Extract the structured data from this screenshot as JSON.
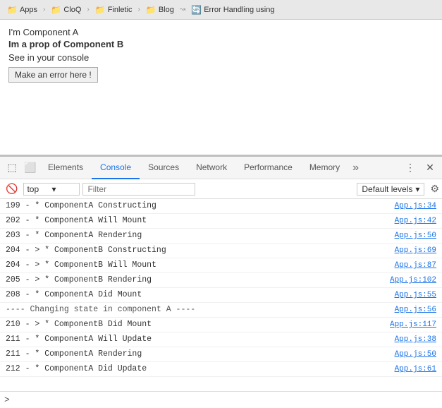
{
  "tabbar": {
    "items": [
      {
        "label": "Apps",
        "icon": "📁"
      },
      {
        "label": "CloQ",
        "icon": "📁"
      },
      {
        "label": "Finletic",
        "icon": "📁"
      },
      {
        "label": "Blog",
        "icon": "📁"
      },
      {
        "label": "Error Handling using",
        "icon": "🔄"
      }
    ]
  },
  "page": {
    "line1": "I'm Component A",
    "line2": "Im a prop of Component B",
    "line3": "See in your console",
    "button_label": "Make an error here !"
  },
  "devtools": {
    "tabs": [
      {
        "label": "Elements",
        "active": false
      },
      {
        "label": "Console",
        "active": true
      },
      {
        "label": "Sources",
        "active": false
      },
      {
        "label": "Network",
        "active": false
      },
      {
        "label": "Performance",
        "active": false
      },
      {
        "label": "Memory",
        "active": false
      }
    ],
    "filter": {
      "context": "top",
      "placeholder": "Filter",
      "levels": "Default levels"
    },
    "logs": [
      {
        "line": "199 - * ComponentA Constructing",
        "ref": "App.js:34"
      },
      {
        "line": "202 - * ComponentA Will Mount",
        "ref": "App.js:42"
      },
      {
        "line": "203 - * ComponentA Rendering",
        "ref": "App.js:50"
      },
      {
        "line": "204 - > * ComponentB Constructing",
        "ref": "App.js:69"
      },
      {
        "line": "204 - > * ComponentB Will Mount",
        "ref": "App.js:87"
      },
      {
        "line": "205 - > * ComponentB Rendering",
        "ref": "App.js:102"
      },
      {
        "line": "208 - * ComponentA Did Mount",
        "ref": "App.js:55"
      },
      {
        "line": "---- Changing state in component A ----",
        "ref": "App.js:56"
      },
      {
        "line": "210 - > * ComponentB Did Mount",
        "ref": "App.js:117"
      },
      {
        "line": "211 - * ComponentA Will Update",
        "ref": "App.js:38"
      },
      {
        "line": "211 - * ComponentA Rendering",
        "ref": "App.js:50"
      },
      {
        "line": "212 - * ComponentA Did Update",
        "ref": "App.js:61"
      }
    ]
  }
}
